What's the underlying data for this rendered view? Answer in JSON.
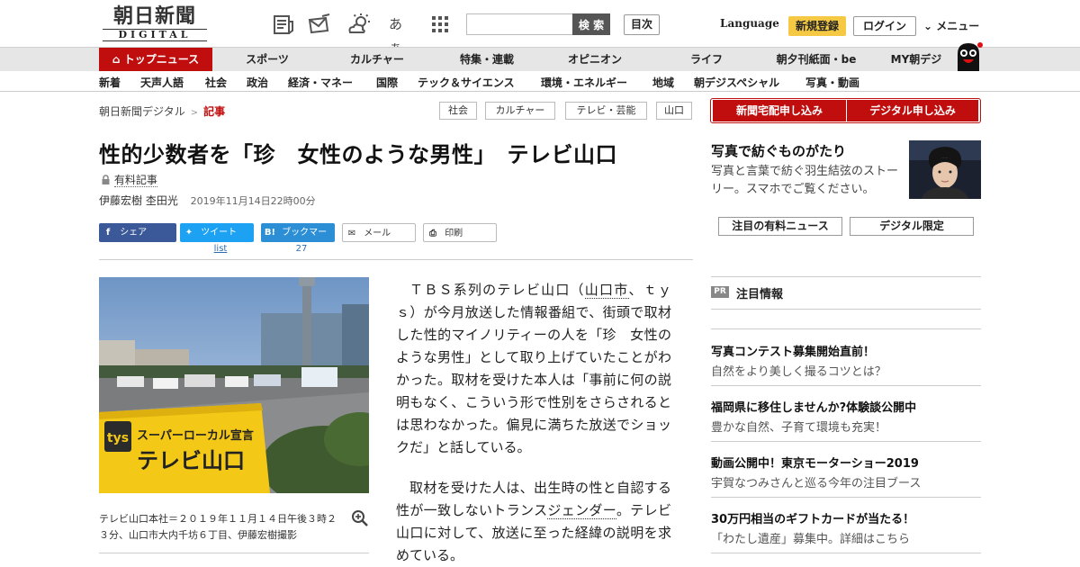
{
  "header": {
    "logo_kanji": "朝日新聞",
    "logo_digital": "DIGITAL",
    "icons": [
      "newspaper-icon",
      "mail-icon",
      "weather-icon",
      "font-size-icon",
      "grid-menu-icon"
    ],
    "font_size_label": "あぁ",
    "search_placeholder": "",
    "search_button": "検 索",
    "mokuji_button": "目次",
    "language_link": "Language",
    "register_button": "新規登録",
    "login_button": "ログイン",
    "menu_link": "メニュー"
  },
  "nav_main": [
    "トップニュース",
    "スポーツ",
    "カルチャー",
    "特集・連載",
    "オピニオン",
    "ライフ",
    "朝夕刊紙面・be",
    "MY朝デジ"
  ],
  "nav_sub": [
    "新着",
    "天声人語",
    "社会",
    "政治",
    "経済・マネー",
    "国際",
    "テック＆サイエンス",
    "環境・エネルギー",
    "地域",
    "朝デジスペシャル",
    "写真・動画"
  ],
  "breadcrumb": {
    "home": "朝日新聞デジタル",
    "separator": ">",
    "current": "記事"
  },
  "tags": [
    "社会",
    "カルチャー",
    "テレビ・芸能",
    "山口"
  ],
  "article": {
    "title": "性的少数者を「珍　女性のような男性」　テレビ山口",
    "paid_label": "有料記事",
    "authors": "伊藤宏樹 杢田光",
    "date": "2019年11月14日22時00分",
    "share": {
      "facebook": "シェア",
      "twitter": "ツイート",
      "hatena_mark": "B!",
      "hatena": "ブックマーク",
      "mail": "メール",
      "print": "印刷",
      "twitter_count": "list",
      "hatena_count": "27"
    },
    "photo_sign_logo": "tys",
    "photo_sign_line1": "スーパーローカル宣言",
    "photo_sign_line2": "テレビ山口",
    "caption": "テレビ山口本社＝２０１９年１１月１４日午後３時２３分、山口市大内千坊６丁目、伊藤宏樹撮影",
    "p1_a": "ＴＢＳ系列のテレビ山口（",
    "p1_link": "山口市",
    "p1_b": "、ｔｙｓ）が今月放送した情報番組で、街頭で取材した性的マイノリティーの人を「珍　女性のような男性」として取り上げていたことがわかった。取材を受けた本人は「事前に何の説明もなく、こういう形で性別をさらされるとは思わなかった。偏見に満ちた放送でショックだ」と話している。",
    "p2_a": "取材を受けた人は、出生時の性と自認する性が一致しないトランス",
    "p2_link": "ジェンダー",
    "p2_b": "。テレビ山口に対して、放送に至った経緯の説明を求めている。"
  },
  "sidebar": {
    "subscribe_paper": "新聞宅配申し込み",
    "subscribe_digital": "デジタル申し込み",
    "feature_title": "写真で紡ぐものがたり",
    "feature_desc": "写真と言葉で紡ぐ羽生結弦のストーリー。スマホでご覧ください。",
    "tab_paid": "注目の有料ニュース",
    "tab_digital": "デジタル限定",
    "pr_badge": "PR",
    "pr_heading": "注目情報",
    "pr_items": [
      {
        "title": "写真コンテスト募集開始直前！",
        "sub": "自然をより美しく撮るコツとは？"
      },
      {
        "title": "福岡県に移住しませんか?体験談公開中",
        "sub": "豊かな自然、子育て環境も充実！"
      },
      {
        "title": "動画公開中！東京モーターショー2019",
        "sub": "宇賀なつみさんと巡る今年の注目ブース"
      },
      {
        "title": "30万円相当のギフトカードが当たる！",
        "sub": "「わたし遺産」募集中。詳細はこちら"
      }
    ]
  }
}
